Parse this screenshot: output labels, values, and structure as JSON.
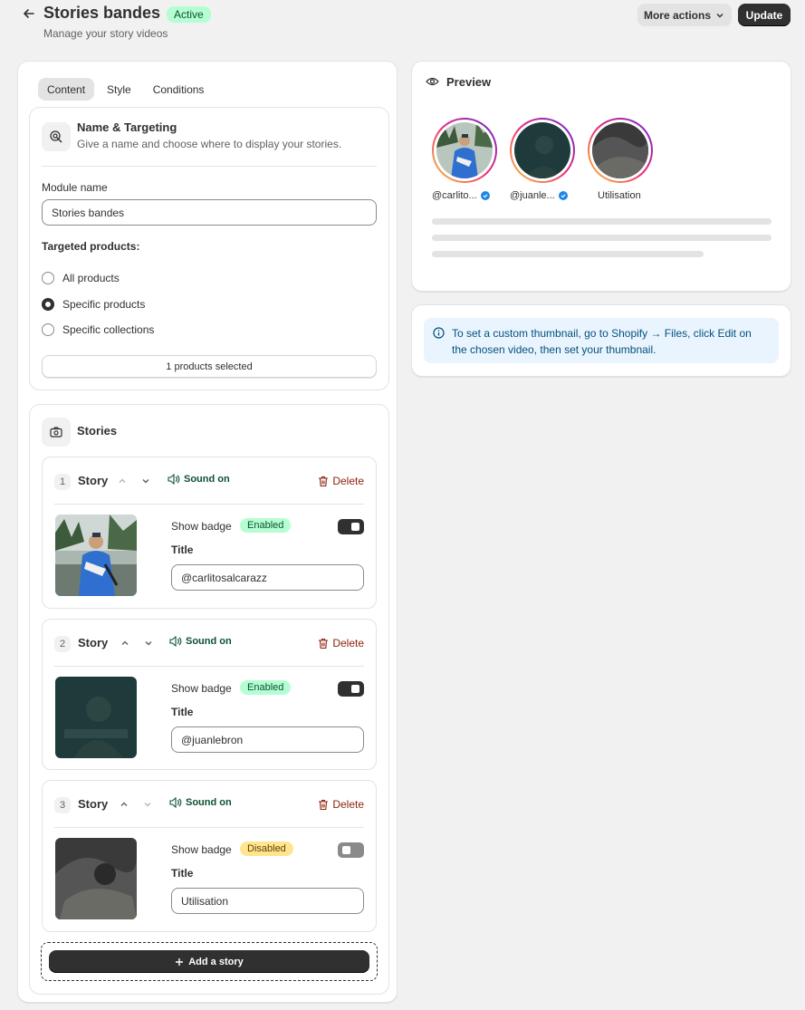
{
  "header": {
    "title": "Stories bandes",
    "status": "Active",
    "subtitle": "Manage your story videos",
    "more_actions": "More actions",
    "update": "Update"
  },
  "tabs": [
    "Content",
    "Style",
    "Conditions"
  ],
  "targeting": {
    "title": "Name & Targeting",
    "description": "Give a name and choose where to display your stories.",
    "module_name_label": "Module name",
    "module_name_value": "Stories bandes",
    "targeted_label": "Targeted products:",
    "options": [
      "All products",
      "Specific products",
      "Specific collections"
    ],
    "selected_option": "Specific products",
    "selection_button": "1 products selected"
  },
  "stories": {
    "title": "Stories",
    "items": [
      {
        "index": "1",
        "label": "Story",
        "sound": "Sound on",
        "delete": "Delete",
        "show_badge": "Show badge",
        "badge_state": "Enabled",
        "badge_enabled": true,
        "title_label": "Title",
        "title_value": "@carlitosalcarazz"
      },
      {
        "index": "2",
        "label": "Story",
        "sound": "Sound on",
        "delete": "Delete",
        "show_badge": "Show badge",
        "badge_state": "Enabled",
        "badge_enabled": true,
        "title_label": "Title",
        "title_value": "@juanlebron"
      },
      {
        "index": "3",
        "label": "Story",
        "sound": "Sound on",
        "delete": "Delete",
        "show_badge": "Show badge",
        "badge_state": "Disabled",
        "badge_enabled": false,
        "title_label": "Title",
        "title_value": "Utilisation"
      }
    ],
    "add_button": "Add a story"
  },
  "preview": {
    "title": "Preview",
    "avatars": [
      {
        "name": "@carlito...",
        "verified": true
      },
      {
        "name": "@juanle...",
        "verified": true
      },
      {
        "name": "Utilisation",
        "verified": false
      }
    ]
  },
  "info": {
    "text": "To set a custom thumbnail, go to Shopify → Files, click Edit on the chosen video, then set your thumbnail."
  },
  "colors": {
    "primary_button": "#303030",
    "success_badge": "#b4fed2",
    "warning_badge": "#ffe58f",
    "delete_text": "#8e1f0b",
    "info_background": "#eaf4ff"
  }
}
